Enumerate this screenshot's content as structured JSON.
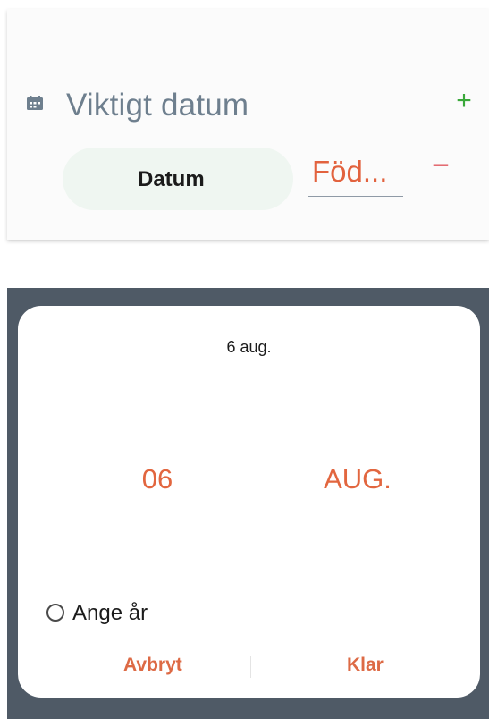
{
  "section": {
    "icon": "calendar-icon",
    "title": "Viktigt datum",
    "add_label": "+",
    "title_color": "#6e7f8e",
    "add_color": "#3aa83a"
  },
  "row": {
    "type_label": "Datum",
    "value": "Föd...",
    "remove_label": "−",
    "value_color": "#e2623e",
    "remove_color": "#e05a60"
  },
  "dialog": {
    "header": "6 aug.",
    "day": "06",
    "month": "AUG.",
    "year_option_label": "Ange år",
    "year_option_checked": false,
    "cancel_label": "Avbryt",
    "confirm_label": "Klar",
    "accent_color": "#e2663f"
  }
}
